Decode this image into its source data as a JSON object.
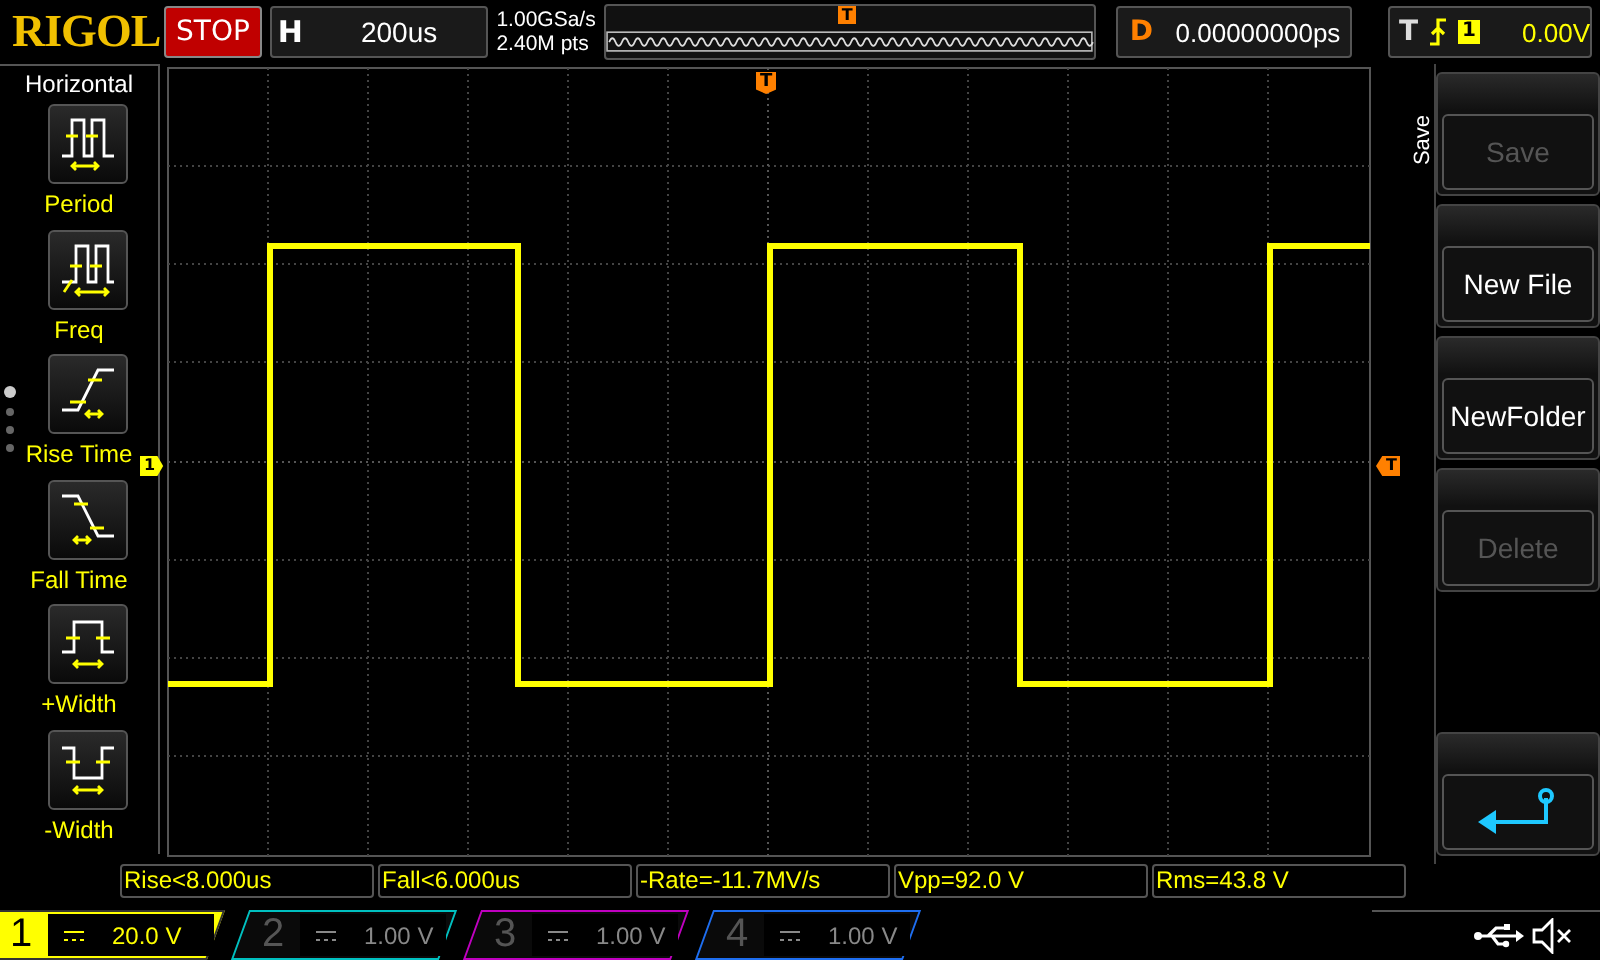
{
  "brand": "RIGOL",
  "run_state": "STOP",
  "timebase": {
    "label": "H",
    "value": "200us"
  },
  "sample_rate": "1.00GSa/s",
  "memory_depth": "2.40M pts",
  "delay": {
    "label": "D",
    "value": "0.00000000ps"
  },
  "trigger": {
    "label": "T",
    "channel": "1",
    "level": "0.00V"
  },
  "left_menu": {
    "title": "Horizontal",
    "items": [
      {
        "kind": "period",
        "label": "Period"
      },
      {
        "kind": "freq",
        "label": "Freq"
      },
      {
        "kind": "rise",
        "label": "Rise Time"
      },
      {
        "kind": "fall",
        "label": "Fall Time"
      },
      {
        "kind": "pwidth",
        "label": "+Width"
      },
      {
        "kind": "nwidth",
        "label": "-Width"
      }
    ]
  },
  "overview_marker": "T",
  "markers": {
    "channel": "1",
    "trigger_top": "T",
    "trigger_right": "T"
  },
  "right_menu": {
    "title": "Save",
    "buttons": [
      {
        "kind": "text",
        "label": "Save",
        "disabled": true
      },
      {
        "kind": "text",
        "label": "New File",
        "disabled": false
      },
      {
        "kind": "text",
        "label": "NewFolder",
        "disabled": false
      },
      {
        "kind": "text",
        "label": "Delete",
        "disabled": true
      },
      {
        "kind": "back"
      }
    ]
  },
  "measurements": [
    "Rise<8.000us",
    "Fall<6.000us",
    "-Rate=-11.7MV/s",
    "Vpp=92.0 V",
    "Rms=43.8 V"
  ],
  "channels": [
    {
      "number": "1",
      "scale": "20.0 V",
      "active": true,
      "color": "#ffff00"
    },
    {
      "number": "2",
      "scale": "1.00 V",
      "active": false,
      "color": "#00c0c0"
    },
    {
      "number": "3",
      "scale": "1.00 V",
      "active": false,
      "color": "#c000c0"
    },
    {
      "number": "4",
      "scale": "1.00 V",
      "active": false,
      "color": "#1e6ef0"
    }
  ]
}
